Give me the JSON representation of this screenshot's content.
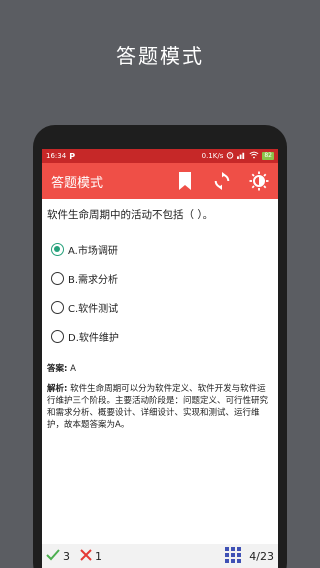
{
  "promo": {
    "title": "答题模式"
  },
  "status_bar": {
    "time": "16:34",
    "carrier_icon": "P",
    "network_speed": "0.1K/s",
    "battery": "82"
  },
  "app_bar": {
    "title": "答题模式",
    "icons": [
      "bookmark-icon",
      "sync-icon",
      "brightness-icon"
    ]
  },
  "question": {
    "text": "软件生命周期中的活动不包括（ ）。",
    "options": [
      {
        "label": "A.市场调研",
        "selected": true
      },
      {
        "label": "B.需求分析",
        "selected": false
      },
      {
        "label": "C.软件测试",
        "selected": false
      },
      {
        "label": "D.软件维护",
        "selected": false
      }
    ]
  },
  "answer": {
    "label": "答案:",
    "value": "A"
  },
  "explanation": {
    "label": "解析:",
    "text": "软件生命周期可以分为软件定义、软件开发与软件运行维护三个阶段。主要活动阶段是：问题定义、可行性研究和需求分析、概要设计、详细设计、实现和测试、运行维护，故本题答案为A。"
  },
  "bottom_bar": {
    "correct_count": "3",
    "wrong_count": "1",
    "progress": "4/23"
  },
  "colors": {
    "status_bar": "#c62828",
    "app_bar": "#ef4f47",
    "radio_checked": "#26a17b",
    "correct": "#4caf50",
    "wrong": "#e53935",
    "grid_icon": "#3f51b5"
  }
}
